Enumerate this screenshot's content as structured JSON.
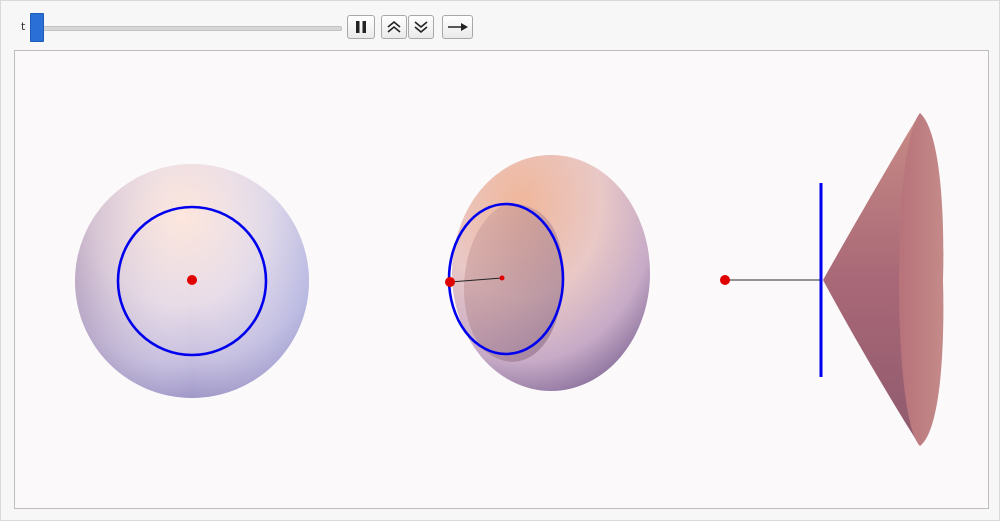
{
  "manipulate": {
    "parameter_label": "t",
    "slider_value": 0.0
  },
  "controls": {
    "pause_icon": "pause-icon",
    "faster_icon": "double-chevron-up-icon",
    "slower_icon": "double-chevron-down-icon",
    "direction_icon": "arrow-right-icon"
  },
  "colors": {
    "accent": "#2a6fd6",
    "circle": "#0000ee",
    "point": "#e00000"
  }
}
